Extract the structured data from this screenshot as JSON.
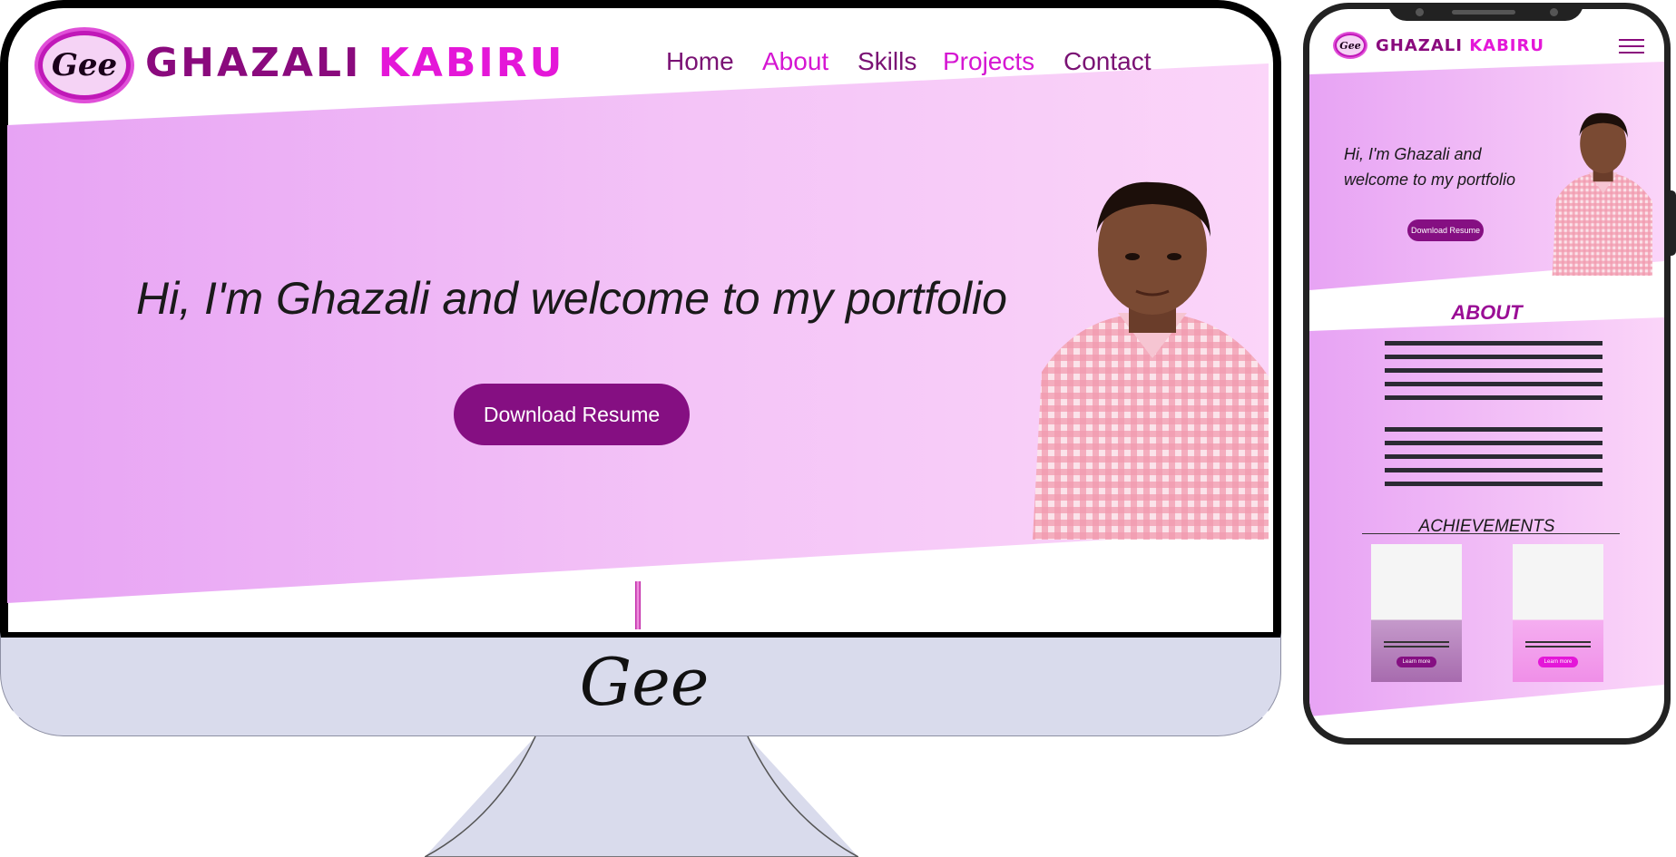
{
  "brand": {
    "logo_text": "Gee",
    "first_name": "GHAZALI",
    "last_name": "KABIRU"
  },
  "nav": {
    "items": [
      {
        "label": "Home",
        "color": "#7a1274"
      },
      {
        "label": "About",
        "color": "#d516d2"
      },
      {
        "label": "Skills",
        "color": "#7a1274"
      },
      {
        "label": "Projects",
        "color": "#d516d2"
      },
      {
        "label": "Contact",
        "color": "#7a1274"
      }
    ]
  },
  "hero": {
    "headline": "Hi, I'm Ghazali and welcome to my  portfolio",
    "button_label": "Download Resume"
  },
  "monitor": {
    "chin_signature": "Gee"
  },
  "mobile": {
    "headline": "Hi, I'm Ghazali and welcome to my  portfolio",
    "button_label": "Download Resume",
    "about_title": "ABOUT",
    "achievements_title": "ACHIEVEMENTS",
    "cards": [
      {
        "button_label": "Learn more"
      },
      {
        "button_label": "Learn more"
      }
    ]
  },
  "colors": {
    "accent_dark": "#850f82",
    "accent_bright": "#e417d8",
    "hero_gradient_start": "#e7a3f4",
    "hero_gradient_end": "#fbd5f9"
  },
  "icons": [
    "logo-icon",
    "hamburger-menu-icon"
  ]
}
